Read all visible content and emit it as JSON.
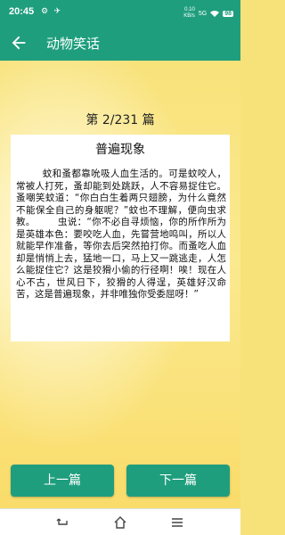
{
  "status_bar": {
    "time": "20:45",
    "left_icons": "⚙ ✈",
    "net_speed": "0.10",
    "net_unit": "KB/s",
    "signal_text": "5G",
    "battery": "98"
  },
  "app_bar": {
    "back_icon": "back-arrow-icon",
    "title": "动物笑话"
  },
  "page_counter": "第 2/231 篇",
  "article": {
    "title": "普遍现象",
    "body": "        蚊和蚤都靠吮吸人血生活的。可是蚊咬人，常被人打死，蚤却能到处跳跃，人不容易捉住它。       蚤嘲笑蚊道：“你白白生着两只翅膀，为什么竟然不能保全自己的身躯呢？”蚊也不理解，便向虫求教。       虫说：“你不必自寻烦恼，你的所作所为是英雄本色：要咬吃人血，先嘗营地鸣叫，所以人就能早作准备，等你去后突然拍打你。而蚤吃人血却是悄悄上去，猛地一口，马上又一跳逃走，人怎么能捉住它？这是狡猾小偷的行径啊！唉！现在人心不古，世风日下，狡猾的人得逞，英雄好汉命苦，这是普遍现象，并非唯独你受委屈呀！”"
  },
  "buttons": {
    "prev": "上一篇",
    "next": "下一篇"
  },
  "nav_bar": {
    "back": "nav-back-icon",
    "home": "nav-home-icon",
    "menu": "nav-menu-icon"
  },
  "colors": {
    "primary": "#1f9e7e",
    "background": "#f7e27a"
  }
}
